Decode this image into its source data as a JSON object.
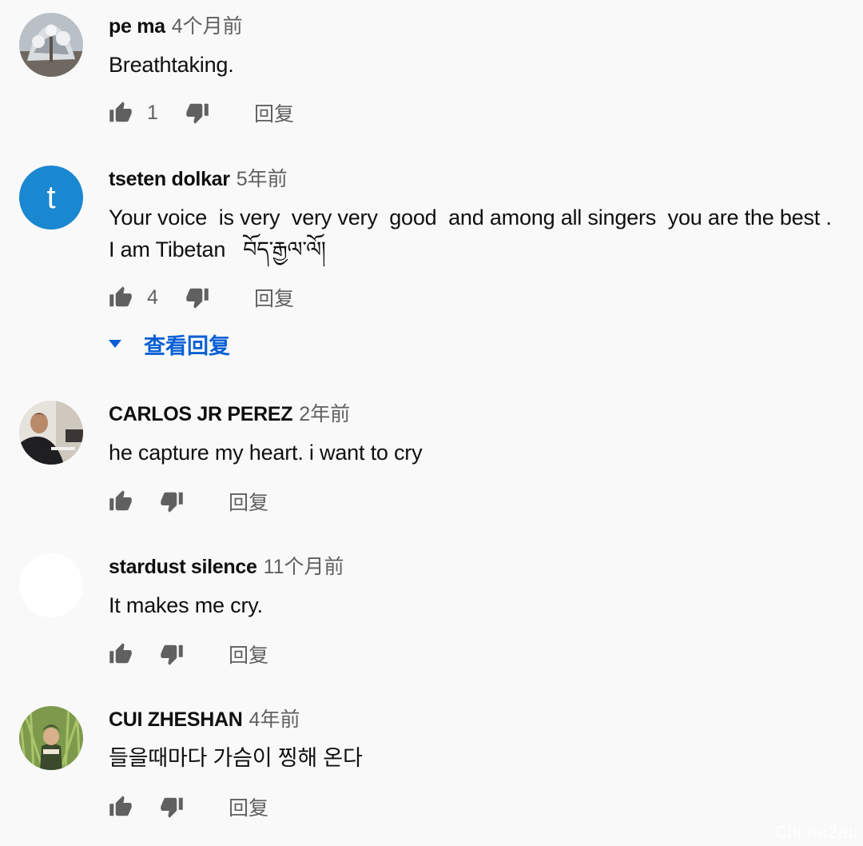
{
  "reply_label": "回复",
  "view_replies_label": "查看回复",
  "comments": [
    {
      "author": "pe ma",
      "time": "4个月前",
      "lines": [
        "Breathtaking."
      ],
      "likes": "1"
    },
    {
      "author": "tseten dolkar",
      "time": "5年前",
      "avatar_letter": "t",
      "lines": [
        "Your voice  is very  very very  good  and among all singers  you are the best .",
        "I am Tibetan   བོད་རྒྱལ་ལོ།"
      ],
      "likes": "4"
    },
    {
      "author": "CARLOS JR PEREZ",
      "time": "2年前",
      "lines": [
        "he capture my heart. i want to cry"
      ]
    },
    {
      "author": "stardust silence",
      "time": "11个月前",
      "lines": [
        "It makes me cry."
      ]
    },
    {
      "author": "CUI ZHESHAN",
      "time": "4年前",
      "lines": [
        "들을때마다 가슴이 찡해 온다"
      ]
    }
  ],
  "watermark": "Chi na2au",
  "colors": {
    "background": "#f9f9f9",
    "link": "#065fd4",
    "secondary": "#606060",
    "avatar_blue": "#1a87d1"
  }
}
